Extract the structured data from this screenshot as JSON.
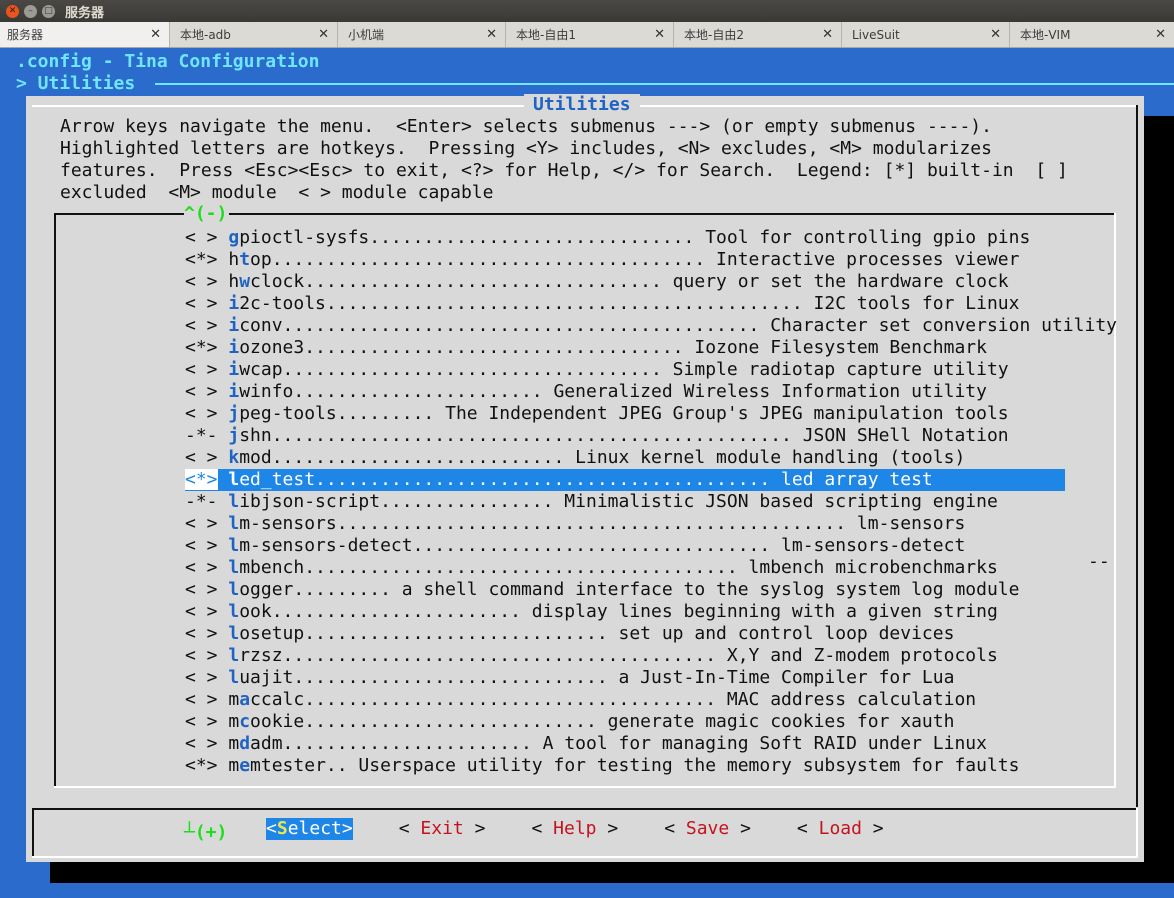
{
  "window": {
    "title": "服务器"
  },
  "tabs": [
    {
      "label": "服务器"
    },
    {
      "label": "本地-adb"
    },
    {
      "label": "小机端"
    },
    {
      "label": "本地-自由1"
    },
    {
      "label": "本地-自由2"
    },
    {
      "label": "LiveSuit"
    },
    {
      "label": "本地-VIM"
    }
  ],
  "tab_close": "✕",
  "terminal": {
    "header_line1": ".config - Tina Configuration",
    "header_line2": "> Utilities",
    "dialog_title": "Utilities",
    "help_text": "Arrow keys navigate the menu.  <Enter> selects submenus ---> (or empty submenus ----).\nHighlighted letters are hotkeys.  Pressing <Y> includes, <N> excludes, <M> modularizes\nfeatures.  Press <Esc><Esc> to exit, <?> for Help, </> for Search.  Legend: [*] built-in  [ ]\nexcluded  <M> module  < > module capable",
    "scroll_up": "^(-)",
    "scroll_down": "┴(+)",
    "side_marker": "--",
    "colors": {
      "terminal_bg": "#2a6bcc",
      "dialog_bg": "#d9d9d9",
      "highlight": "#1e86e6",
      "hotkey": "#1f63c4",
      "scroll_indicator": "#19e019",
      "button_hotkey": "#c4131d"
    }
  },
  "menu": [
    {
      "state": "< >",
      "h": "g",
      "rest": "pioctl-sysfs.............................. Tool for controlling gpio pins"
    },
    {
      "state": "<*>",
      "pre": "h",
      "h": "t",
      "rest": "op........................................ Interactive processes viewer",
      "fmt": "2"
    },
    {
      "state": "< >",
      "pre": "h",
      "h": "w",
      "rest": "clock................................. query or set the hardware clock",
      "fmt": "2"
    },
    {
      "state": "< >",
      "h": "i",
      "rest": "2c-tools............................................ I2C tools for Linux"
    },
    {
      "state": "< >",
      "h": "i",
      "rest": "conv............................................ Character set conversion utility"
    },
    {
      "state": "<*>",
      "h": "i",
      "rest": "ozone3................................... Iozone Filesystem Benchmark"
    },
    {
      "state": "< >",
      "h": "i",
      "rest": "wcap................................... Simple radiotap capture utility"
    },
    {
      "state": "< >",
      "h": "i",
      "rest": "winfo....................... Generalized Wireless Information utility"
    },
    {
      "state": "< >",
      "h": "j",
      "rest": "peg-tools......... The Independent JPEG Group's JPEG manipulation tools"
    },
    {
      "state": "-*-",
      "h": "j",
      "rest": "shn................................................ JSON SHell Notation"
    },
    {
      "state": "< >",
      "h": "k",
      "rest": "mod........................... Linux kernel module handling (tools)"
    },
    {
      "state": "<*>",
      "h": "l",
      "rest": "ed_test.......................................... led array test",
      "selected": true
    },
    {
      "state": "-*-",
      "h": "l",
      "rest": "ibjson-script................ Minimalistic JSON based scripting engine"
    },
    {
      "state": "< >",
      "h": "l",
      "rest": "m-sensors............................................... lm-sensors"
    },
    {
      "state": "< >",
      "h": "l",
      "rest": "m-sensors-detect................................. lm-sensors-detect"
    },
    {
      "state": "< >",
      "h": "l",
      "rest": "mbench........................................ lmbench microbenchmarks"
    },
    {
      "state": "< >",
      "h": "l",
      "rest": "ogger......... a shell command interface to the syslog system log module"
    },
    {
      "state": "< >",
      "h": "l",
      "rest": "ook....................... display lines beginning with a given string"
    },
    {
      "state": "< >",
      "h": "l",
      "rest": "osetup............................ set up and control loop devices"
    },
    {
      "state": "< >",
      "h": "l",
      "rest": "rzsz........................................ X,Y and Z-modem protocols"
    },
    {
      "state": "< >",
      "h": "l",
      "rest": "uajit............................. a Just-In-Time Compiler for Lua"
    },
    {
      "state": "< >",
      "pre": "m",
      "h": "a",
      "rest": "ccalc...................................... MAC address calculation",
      "fmt": "2"
    },
    {
      "state": "< >",
      "pre": "m",
      "h": "c",
      "rest": "ookie........................... generate magic cookies for xauth",
      "fmt": "2"
    },
    {
      "state": "< >",
      "pre": "m",
      "h": "d",
      "rest": "adm....................... A tool for managing Soft RAID under Linux",
      "fmt": "2"
    },
    {
      "state": "<*>",
      "pre": "m",
      "h": "e",
      "rest": "mtester.. Userspace utility for testing the memory subsystem for faults",
      "fmt": "2"
    }
  ],
  "buttons": [
    {
      "open": "<",
      "first": "S",
      "rest": "elect",
      "close": ">",
      "active": true
    },
    {
      "open": "< ",
      "first": "E",
      "rest": "xit",
      "close": " >"
    },
    {
      "open": "< ",
      "first": "H",
      "rest": "elp",
      "close": " >"
    },
    {
      "open": "< ",
      "first": "S",
      "rest": "ave",
      "close": " >"
    },
    {
      "open": "< ",
      "first": "L",
      "rest": "oad",
      "close": " >"
    }
  ]
}
